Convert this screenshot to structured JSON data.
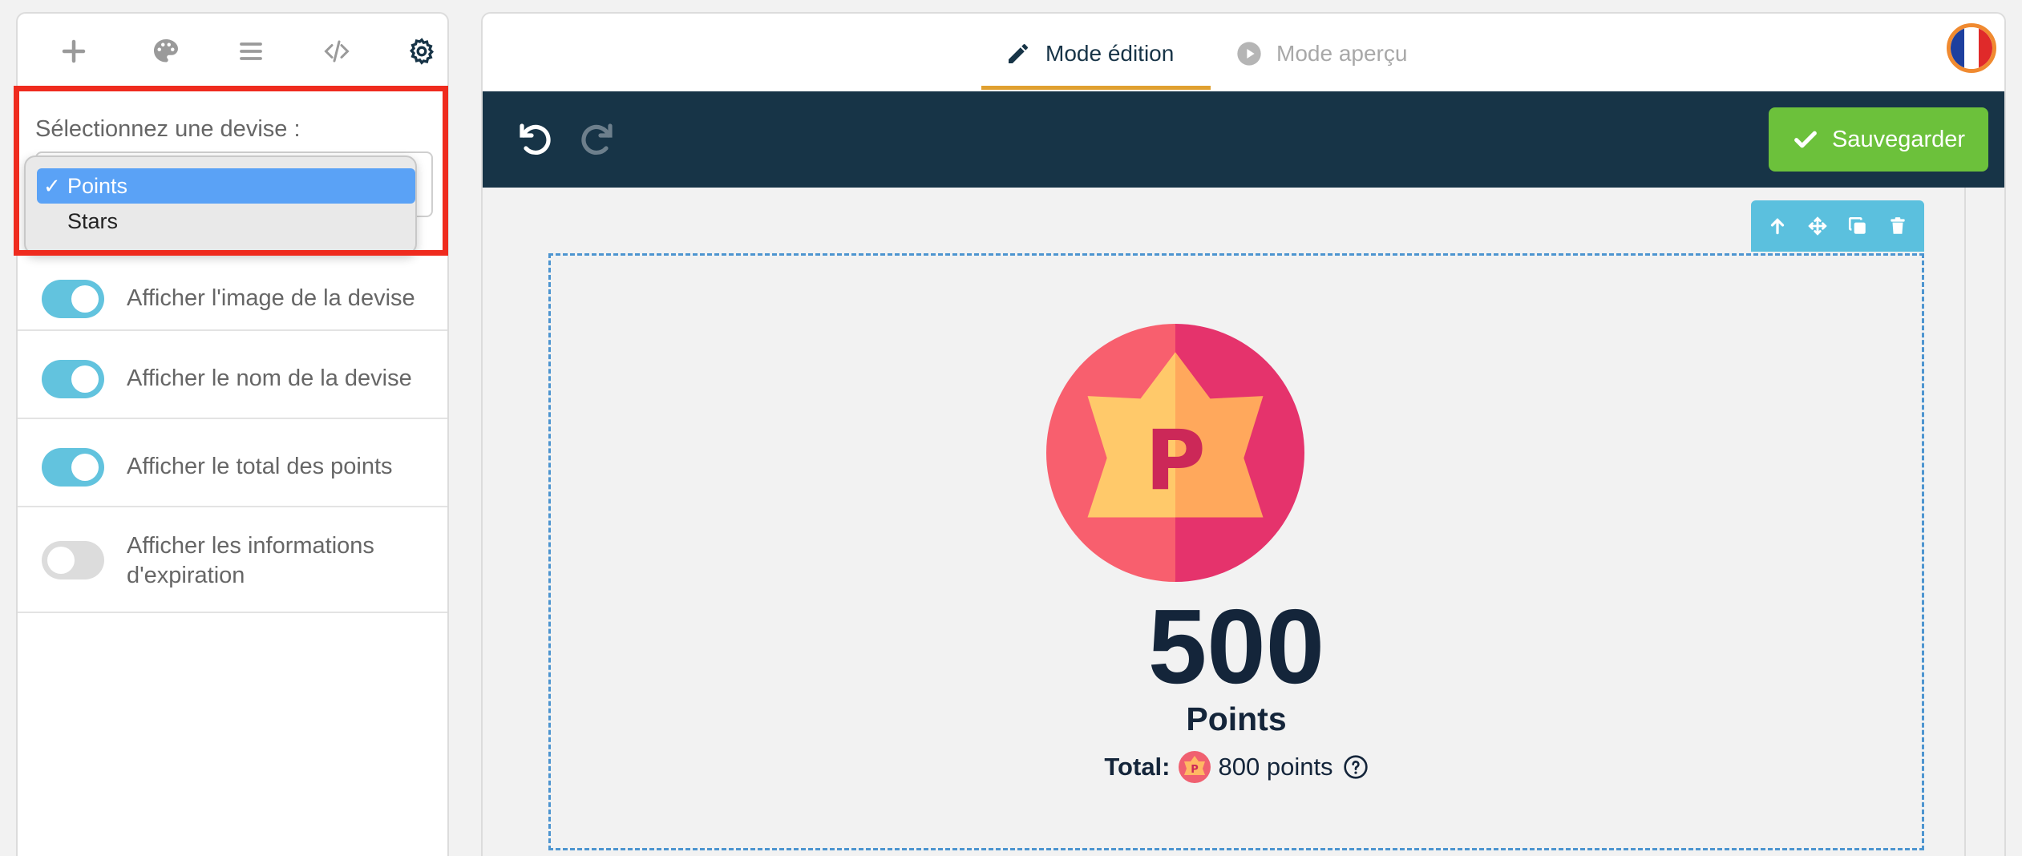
{
  "sidebar": {
    "tabs": [
      {
        "name": "add",
        "icon": "plus-icon"
      },
      {
        "name": "design",
        "icon": "palette-icon"
      },
      {
        "name": "layers",
        "icon": "list-icon"
      },
      {
        "name": "code",
        "icon": "code-icon"
      },
      {
        "name": "settings",
        "icon": "gear-icon",
        "active": true
      }
    ],
    "currency_label": "Sélectionnez une devise :",
    "currency_options": [
      "Points",
      "Stars"
    ],
    "currency_selected": "Points",
    "toggles": [
      {
        "label": "Afficher l'image de la devise",
        "on": true
      },
      {
        "label": "Afficher le nom de la devise",
        "on": true
      },
      {
        "label": "Afficher le total des points",
        "on": true
      },
      {
        "label": "Afficher les informations d'expiration",
        "on": false
      }
    ]
  },
  "header": {
    "edit_mode_label": "Mode édition",
    "preview_mode_label": "Mode aperçu",
    "language_flag": "flag-fr-icon"
  },
  "toolbar": {
    "undo_icon": "undo-icon",
    "redo_icon": "redo-icon",
    "save_label": "Sauvegarder"
  },
  "widget": {
    "amount": "500",
    "currency_name": "Points",
    "total_label": "Total:",
    "total_value": "800 points",
    "coin_letter": "P"
  },
  "colors": {
    "toolbar_bg": "#173447",
    "save_green": "#6cc13b",
    "toggle_on": "#62c3de",
    "selection_border": "#4d95d0",
    "highlight_red": "#ef2b1e",
    "dropdown_selected": "#5aa2f6"
  }
}
